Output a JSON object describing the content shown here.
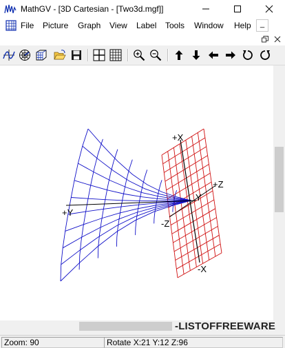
{
  "window": {
    "title": "MathGV - [3D Cartesian - [Two3d.mgf]]",
    "controls": {
      "minimize": "—",
      "maximize": "☐",
      "close": "✕"
    }
  },
  "menu": {
    "items": [
      "File",
      "Picture",
      "Graph",
      "View",
      "Label",
      "Tools",
      "Window",
      "Help"
    ],
    "mdi_minimize": "_",
    "mdi_restore": "🗗",
    "mdi_close": "✕"
  },
  "toolbar": {
    "buttons": [
      "2d-graph-icon",
      "polar-graph-icon",
      "3d-graph-icon",
      "open-folder-icon",
      "save-icon",
      "axes-icon",
      "grid-icon",
      "zoom-in-icon",
      "zoom-out-icon",
      "up-arrow-icon",
      "down-arrow-icon",
      "left-arrow-icon",
      "right-arrow-icon",
      "rotate-ccw-icon",
      "rotate-cw-icon"
    ]
  },
  "canvas": {
    "axis_labels": {
      "plus_x": "+X",
      "minus_x": "-X",
      "plus_y": "+Y",
      "minus_y": "Y",
      "plus_z": "+Z",
      "minus_z": "-Z"
    },
    "colors": {
      "surface1": "#1010c8",
      "surface2": "#d01010",
      "axes": "#000000"
    }
  },
  "watermark": "-LISTOFFREEWARE",
  "status": {
    "zoom": "Zoom: 90",
    "rotate": "Rotate X:21 Y:12 Z:96"
  }
}
